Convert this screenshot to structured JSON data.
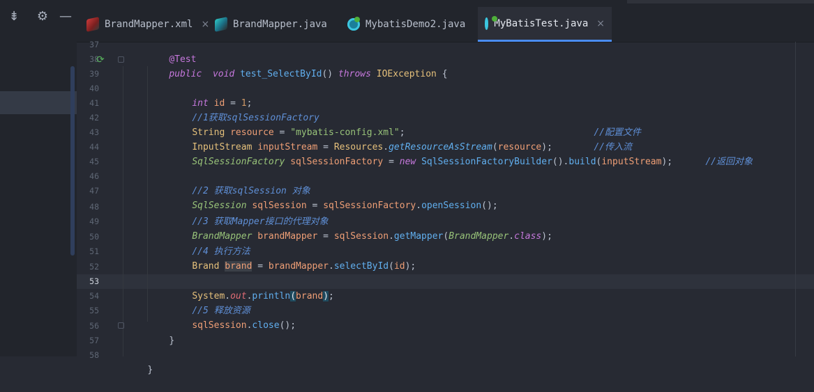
{
  "tabs": [
    {
      "label": "BrandMapper.xml",
      "icon": "xml-file-icon",
      "active": false
    },
    {
      "label": "BrandMapper.java",
      "icon": "java-interface-icon",
      "active": false
    },
    {
      "label": "MybatisDemo2.java",
      "icon": "java-class-icon",
      "active": false
    },
    {
      "label": "MyBatisTest.java",
      "icon": "java-class-icon",
      "active": true
    }
  ],
  "close_glyph": "×",
  "line_numbers": [
    "37",
    "38",
    "39",
    "40",
    "41",
    "42",
    "43",
    "44",
    "45",
    "46",
    "47",
    "48",
    "49",
    "50",
    "51",
    "52",
    "53",
    "54",
    "55",
    "56",
    "57",
    "58"
  ],
  "current_line": "53",
  "code": {
    "l37_ann": "@Test",
    "l38_public": "public",
    "l38_void": "void",
    "l38_name": "test_SelectById",
    "l38_parens": "()",
    "l38_throws": "throws",
    "l38_exc": "IOException",
    "l38_brace": "{",
    "l40_int": "int",
    "l40_id": "id",
    "l40_eq": " = ",
    "l40_num": "1",
    "l40_semi": ";",
    "l41_cmt": "//1获取sqlSessionFactory",
    "l42_type": "String",
    "l42_var": "resource",
    "l42_eq": " = ",
    "l42_str": "\"mybatis-config.xml\"",
    "l42_semi": ";",
    "l42_cmt": "//配置文件",
    "l43_type": "InputStream",
    "l43_var": "inputStream",
    "l43_eq": " = ",
    "l43_cls": "Resources",
    "l43_dot": ".",
    "l43_fn": "getResourceAsStream",
    "l43_open": "(",
    "l43_arg": "resource",
    "l43_close": ");",
    "l43_cmt": "//传入流",
    "l44_type": "SqlSessionFactory",
    "l44_var": "sqlSessionFactory",
    "l44_eq": " = ",
    "l44_new": "new",
    "l44_cls": "SqlSessionFactoryBuilder",
    "l44_parens": "().",
    "l44_fn": "build",
    "l44_open": "(",
    "l44_arg": "inputStream",
    "l44_close": ");",
    "l44_cmt": "//返回对象",
    "l46_cmt": "//2 获取sqlSession 对象",
    "l47_type": "SqlSession",
    "l47_var": "sqlSession",
    "l47_eq": " = ",
    "l47_obj": "sqlSessionFactory",
    "l47_dot": ".",
    "l47_fn": "openSession",
    "l47_close": "();",
    "l48_cmt": "//3 获取Mapper接口的代理对象",
    "l49_type": "BrandMapper",
    "l49_var": "brandMapper",
    "l49_eq": " = ",
    "l49_obj": "sqlSession",
    "l49_dot": ".",
    "l49_fn": "getMapper",
    "l49_open": "(",
    "l49_cls": "BrandMapper",
    "l49_dot2": ".",
    "l49_class": "class",
    "l49_close": ");",
    "l50_cmt": "//4 执行方法",
    "l51_type": "Brand",
    "l51_var": "brand",
    "l51_eq": " = ",
    "l51_obj": "brandMapper",
    "l51_dot": ".",
    "l51_fn": "selectById",
    "l51_open": "(",
    "l51_arg": "id",
    "l51_close": ");",
    "l53_cls": "System",
    "l53_dot": ".",
    "l53_out": "out",
    "l53_dot2": ".",
    "l53_fn": "println",
    "l53_open": "(",
    "l53_arg": "brand",
    "l53_close": ")",
    "l53_semi": ";",
    "l54_cmt": "//5 释放资源",
    "l55_obj": "sqlSession",
    "l55_dot": ".",
    "l55_fn": "close",
    "l55_close": "();",
    "l56_brace": "}",
    "l58_brace": "}"
  },
  "colors": {
    "background": "#272a33",
    "keyword": "#c678dd",
    "type": "#e5c07b",
    "string": "#98c379",
    "function": "#61afef",
    "comment": "#5f8fd6",
    "active_tab_underline": "#4a8cf0"
  }
}
